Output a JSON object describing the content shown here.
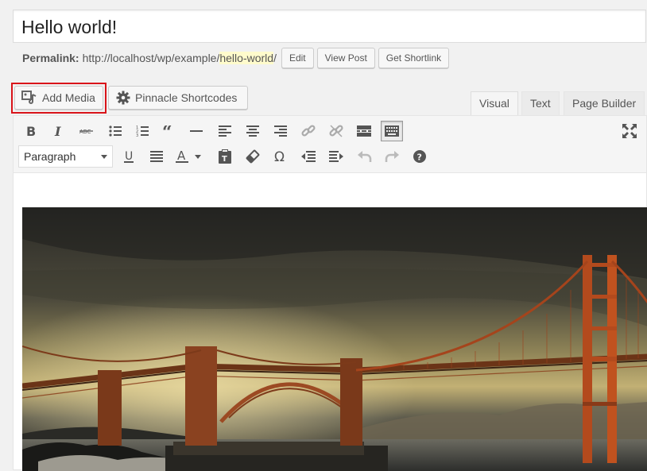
{
  "post": {
    "title": "Hello world!"
  },
  "permalink": {
    "label": "Permalink:",
    "base": "http://localhost/wp/example/",
    "slug": "hello-world",
    "trail": "/",
    "edit_label": "Edit",
    "view_label": "View Post",
    "shortlink_label": "Get Shortlink"
  },
  "media_buttons": {
    "add_media": "Add Media",
    "pinnacle": "Pinnacle Shortcodes"
  },
  "editor_tabs": [
    {
      "label": "Visual",
      "active": true
    },
    {
      "label": "Text",
      "active": false
    },
    {
      "label": "Page Builder",
      "active": false
    }
  ],
  "toolbar": {
    "row1": [
      "bold-icon",
      "italic-icon",
      "strikethrough-icon",
      "bullet-list-icon",
      "numbered-list-icon",
      "blockquote-icon",
      "horizontal-line-icon",
      "align-left-icon",
      "align-center-icon",
      "align-right-icon",
      "insert-link-icon",
      "remove-link-icon",
      "read-more-icon",
      "toolbar-toggle-icon"
    ],
    "row2": [
      "underline-icon",
      "justify-icon",
      "text-color-icon",
      "paste-text-icon",
      "clear-formatting-icon",
      "special-character-icon",
      "outdent-icon",
      "indent-icon",
      "undo-icon",
      "redo-icon",
      "help-icon"
    ],
    "format_select": "Paragraph",
    "fullscreen": "fullscreen-icon"
  },
  "content": {
    "image": "golden-gate-bridge-photo"
  },
  "colors": {
    "highlight_border": "#d9141a",
    "slug_highlight": "#fffbcc"
  }
}
